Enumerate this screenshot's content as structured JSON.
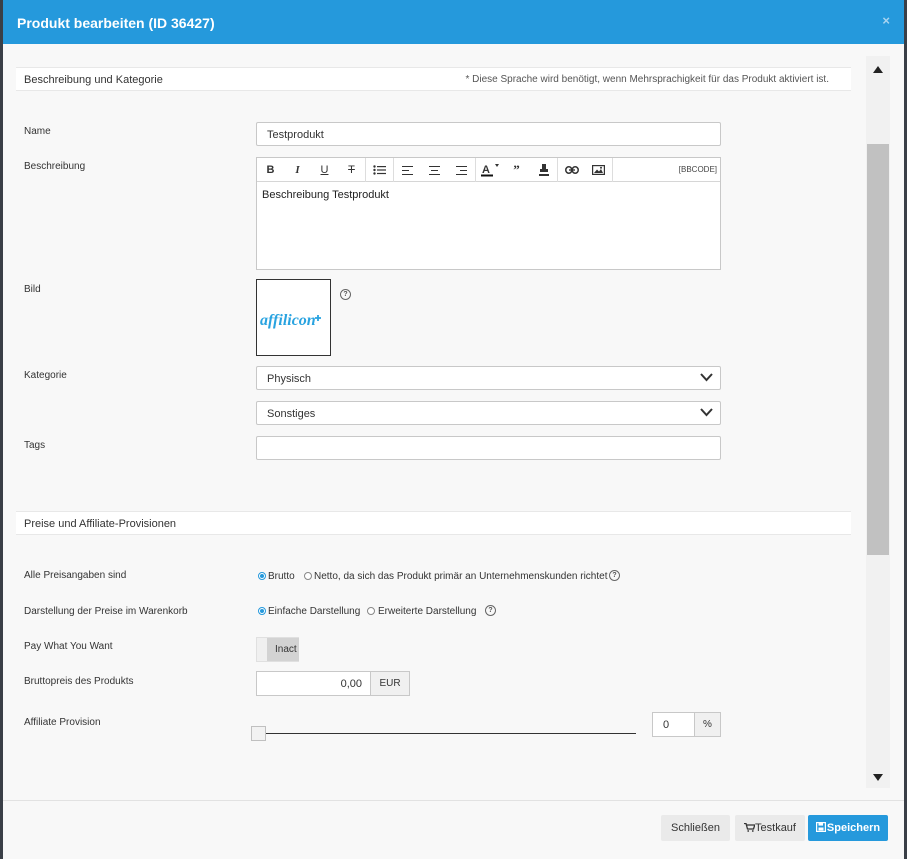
{
  "modal": {
    "title": "Produkt bearbeiten (ID 36427)",
    "close_symbol": "×"
  },
  "section1": {
    "title": "Beschreibung und Kategorie",
    "note": "* Diese Sprache wird benötigt, wenn Mehrsprachigkeit für das Produkt aktiviert ist."
  },
  "fields": {
    "name_label": "Name",
    "name_value": "Testprodukt",
    "description_label": "Beschreibung",
    "description_value": "Beschreibung Testprodukt",
    "bbcode_label": "[BBCODE]",
    "image_label": "Bild",
    "image_logo_text": "affilicon",
    "category_label": "Kategorie",
    "category_value": "Physisch",
    "subcategory_value": "Sonstiges",
    "tags_label": "Tags",
    "tags_value": ""
  },
  "toolbar": {
    "bold": "B",
    "italic": "I",
    "underline": "U",
    "strike": "T",
    "icons": [
      "bold-icon",
      "italic-icon",
      "underline-icon",
      "strikethrough-icon",
      "bullet-list-icon",
      "align-left-icon",
      "align-center-icon",
      "align-right-icon",
      "text-color-icon",
      "quote-icon",
      "highlight-icon",
      "link-icon",
      "image-icon"
    ]
  },
  "section2": {
    "title": "Preise und Affiliate-Provisionen",
    "price_mode_label": "Alle Preisangaben sind",
    "price_mode_options": [
      "Brutto",
      "Netto, da sich das Produkt primär an Unternehmenskunden richtet"
    ],
    "price_mode_selected": "Brutto",
    "display_label": "Darstellung der Preise im Warenkorb",
    "display_options": [
      "Einfache Darstellung",
      "Erweiterte Darstellung"
    ],
    "display_selected": "Einfache Darstellung",
    "pwyw_label": "Pay What You Want",
    "pwyw_state": "Inact",
    "gross_price_label": "Bruttopreis des Produkts",
    "gross_price_value": "0,00",
    "currency": "EUR",
    "affiliate_label": "Affiliate Provision",
    "affiliate_value": "0",
    "affiliate_unit": "%",
    "affiliate_slider_fraction": 0
  },
  "footer": {
    "close_label": "Schließen",
    "testkauf_label": "Testkauf",
    "save_label": "Speichern"
  },
  "colors": {
    "accent": "#2599dc",
    "logo": "#29a3e0"
  }
}
